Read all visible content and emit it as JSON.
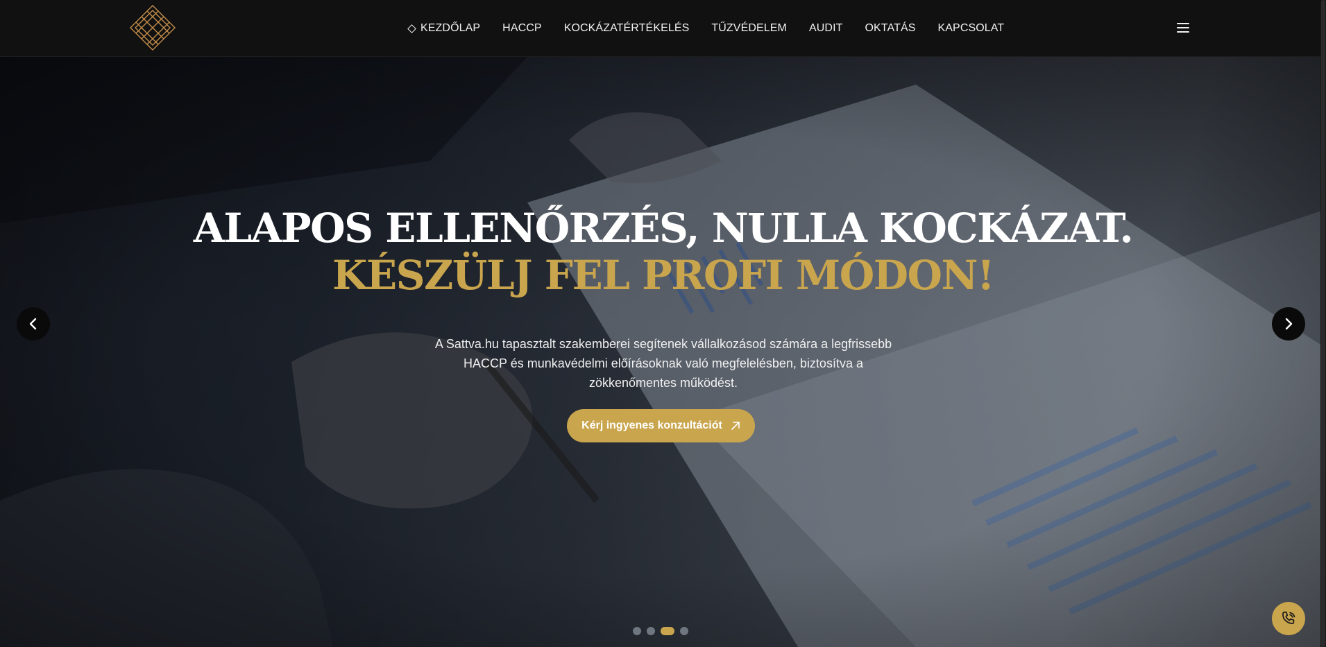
{
  "header": {
    "logo_icon": "diamond-lattice-logo",
    "nav": [
      {
        "label": "KEZDŐLAP",
        "icon": "diamond-icon",
        "active": true
      },
      {
        "label": "HACCP"
      },
      {
        "label": "KOCKÁZATÉRTÉKELÉS"
      },
      {
        "label": "TŰZVÉDELEM"
      },
      {
        "label": "AUDIT"
      },
      {
        "label": "OKTATÁS"
      },
      {
        "label": "KAPCSOLAT"
      }
    ],
    "menu_icon": "hamburger-menu-icon"
  },
  "hero": {
    "headline_line1": "ALAPOS ELLENŐRZÉS, NULLA KOCKÁZAT.",
    "headline_line2": "KÉSZÜLJ FEL PROFI MÓDON!",
    "intro": "A Sattva.hu tapasztalt szakemberei segítenek vállalkozásod számára a legfrissebb HACCP és munkavédelmi előírásoknak való megfelelésben, biztosítva a zökkenőmentes működést.",
    "cta_label": "Kérj ingyenes konzultációt",
    "cta_icon": "arrow-up-right-icon",
    "prev_icon": "chevron-left-icon",
    "next_icon": "chevron-right-icon",
    "slides_total": 4,
    "active_slide": 3
  },
  "floating": {
    "phone_icon": "phone-call-icon"
  },
  "colors": {
    "accent": "#c9a54d",
    "header_bg": "#111111",
    "text": "#ffffff",
    "dot_inactive": "#6f7680"
  }
}
